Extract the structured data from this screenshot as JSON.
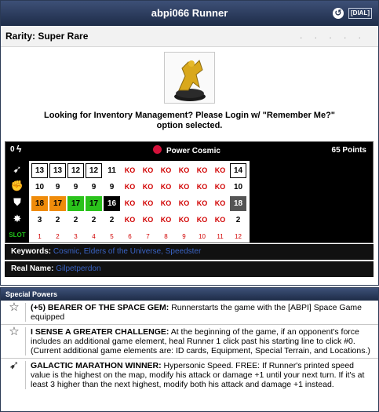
{
  "header": {
    "title": "abpi066 Runner",
    "back_icon": "↺",
    "dial_label": "[DIAL]"
  },
  "rarity": {
    "text": "Rarity: Super Rare",
    "dots": ". . . . ."
  },
  "login_message": "Looking for Inventory Management? Please Login w/ \"Remember Me?\" option selected.",
  "dial": {
    "starting_line": "0",
    "team_ability": "Power Cosmic",
    "points": "65 Points",
    "rows": [
      [
        "13",
        "13",
        "12",
        "12",
        "11",
        "KO",
        "KO",
        "KO",
        "KO",
        "KO",
        "KO",
        "14"
      ],
      [
        "10",
        "9",
        "9",
        "9",
        "9",
        "KO",
        "KO",
        "KO",
        "KO",
        "KO",
        "KO",
        "10"
      ],
      [
        "18",
        "17",
        "17",
        "17",
        "16",
        "KO",
        "KO",
        "KO",
        "KO",
        "KO",
        "KO",
        "18"
      ],
      [
        "3",
        "2",
        "2",
        "2",
        "2",
        "KO",
        "KO",
        "KO",
        "KO",
        "KO",
        "KO",
        "2"
      ]
    ],
    "slot_label": "SLOT",
    "slots": [
      "1",
      "2",
      "3",
      "4",
      "5",
      "6",
      "7",
      "8",
      "9",
      "10",
      "11",
      "12"
    ]
  },
  "keywords": {
    "label": "Keywords:",
    "items": "Cosmic, Elders of the Universe, Speedster"
  },
  "real_name": {
    "label": "Real Name:",
    "value": "Gilpetperdon"
  },
  "special_powers": {
    "heading": "Special Powers",
    "powers": [
      {
        "title": "(+5) BEARER OF THE SPACE GEM:",
        "text": "Runnerstarts the game with the [ABPI] Space Game equipped"
      },
      {
        "title": "I SENSE A GREATER CHALLENGE:",
        "text": "At the beginning of the game, if an opponent's force includes an additional game element, heal Runner 1 click past his starting line to click #0. (Current additional game elements are: ID cards, Equipment, Special Terrain, and Locations.)"
      },
      {
        "title": "GALACTIC MARATHON WINNER:",
        "text": "Hypersonic Speed. FREE: If Runner's printed speed value is the highest on the map, modify his attack or damage +1 until your next turn. If it's at least 3 higher than the next highest, modify both his attack and damage +1 instead."
      }
    ]
  }
}
